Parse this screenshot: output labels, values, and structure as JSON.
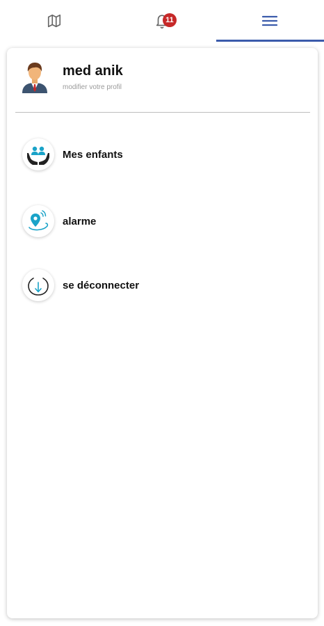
{
  "tabs": [
    {
      "name": "map",
      "icon": "map-icon"
    },
    {
      "name": "notifications",
      "icon": "bell-icon",
      "badge": "11"
    },
    {
      "name": "menu",
      "icon": "hamburger-menu-icon",
      "active": true
    }
  ],
  "colors": {
    "accent": "#3b5bab",
    "badge": "#c62828",
    "teal": "#1aa3c8"
  },
  "profile": {
    "name": "med anik",
    "subtitle": "modifier votre profil",
    "avatar_icon": "user-avatar-icon"
  },
  "menu": [
    {
      "label": "Mes enfants",
      "icon": "children-hands-icon"
    },
    {
      "label": "alarme",
      "icon": "location-alarm-icon"
    },
    {
      "label": "se déconnecter",
      "icon": "logout-icon"
    }
  ]
}
